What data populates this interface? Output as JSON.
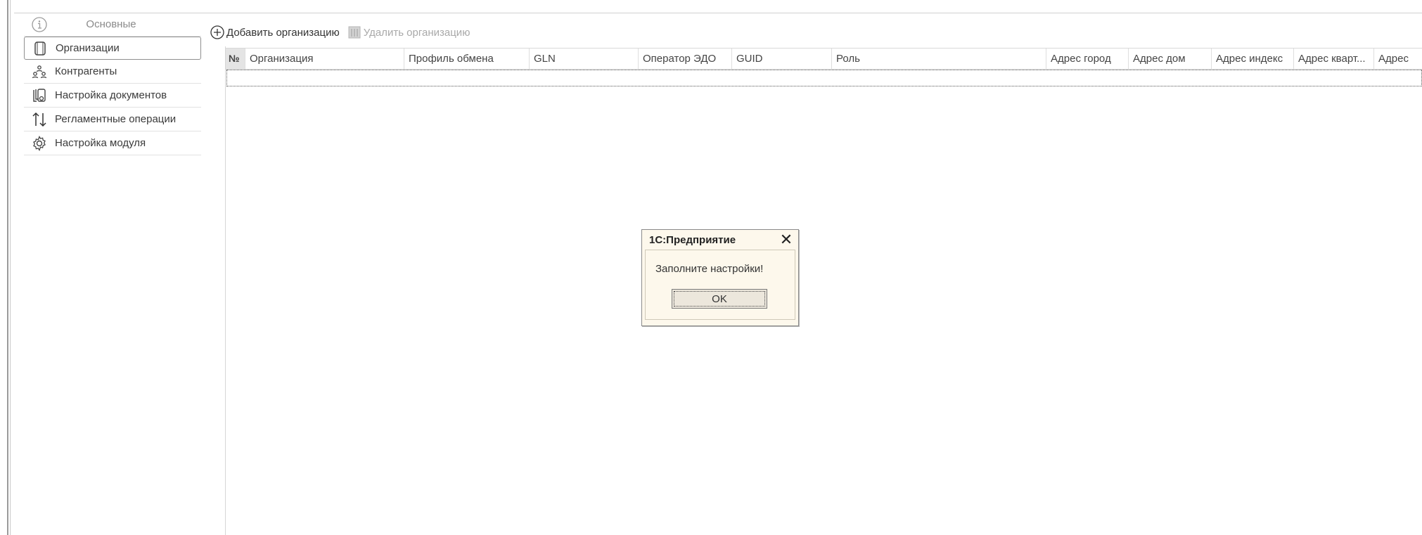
{
  "sidebar": {
    "header_label": "Основные",
    "items": [
      {
        "label": "Организации",
        "icon": "document-icon"
      },
      {
        "label": "Контрагенты",
        "icon": "people-icon"
      },
      {
        "label": "Настройка документов",
        "icon": "documents-settings-icon"
      },
      {
        "label": "Регламентные операции",
        "icon": "up-down-arrows-icon"
      },
      {
        "label": "Настройка модуля",
        "icon": "gear-icon"
      }
    ]
  },
  "toolbar": {
    "add_label": "Добавить организацию",
    "delete_label": "Удалить организацию"
  },
  "table": {
    "columns": [
      "№",
      "Организация",
      "Профиль обмена",
      "GLN",
      "Оператор ЭДО",
      "GUID",
      "Роль",
      "Адрес город",
      "Адрес дом",
      "Адрес индекс",
      "Адрес кварт...",
      "Адрес"
    ]
  },
  "dialog": {
    "title": "1С:Предприятие",
    "message": "Заполните настройки!",
    "ok_label": "OK"
  },
  "colors": {
    "dialog_bg": "#fdf8ec",
    "header_num_bg": "#e4e4e4"
  }
}
